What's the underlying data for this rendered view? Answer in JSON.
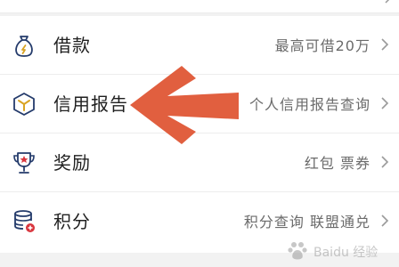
{
  "colors": {
    "accent_arrow": "#e15f3f",
    "icon_stroke": "#243b6b",
    "icon_gold": "#d9a425",
    "icon_red": "#d9363e"
  },
  "menu": {
    "items": [
      {
        "label": "借款",
        "detail": "最高可借20万",
        "icon": "money-bag-icon"
      },
      {
        "label": "信用报告",
        "detail": "个人信用报告查询",
        "icon": "hexagon-report-icon"
      },
      {
        "label": "奖励",
        "detail": "红包 票券",
        "icon": "trophy-icon"
      },
      {
        "label": "积分",
        "detail": "积分查询 联盟通兑",
        "icon": "coins-stack-icon"
      }
    ]
  },
  "watermark": {
    "text": "Baidu 经验"
  }
}
